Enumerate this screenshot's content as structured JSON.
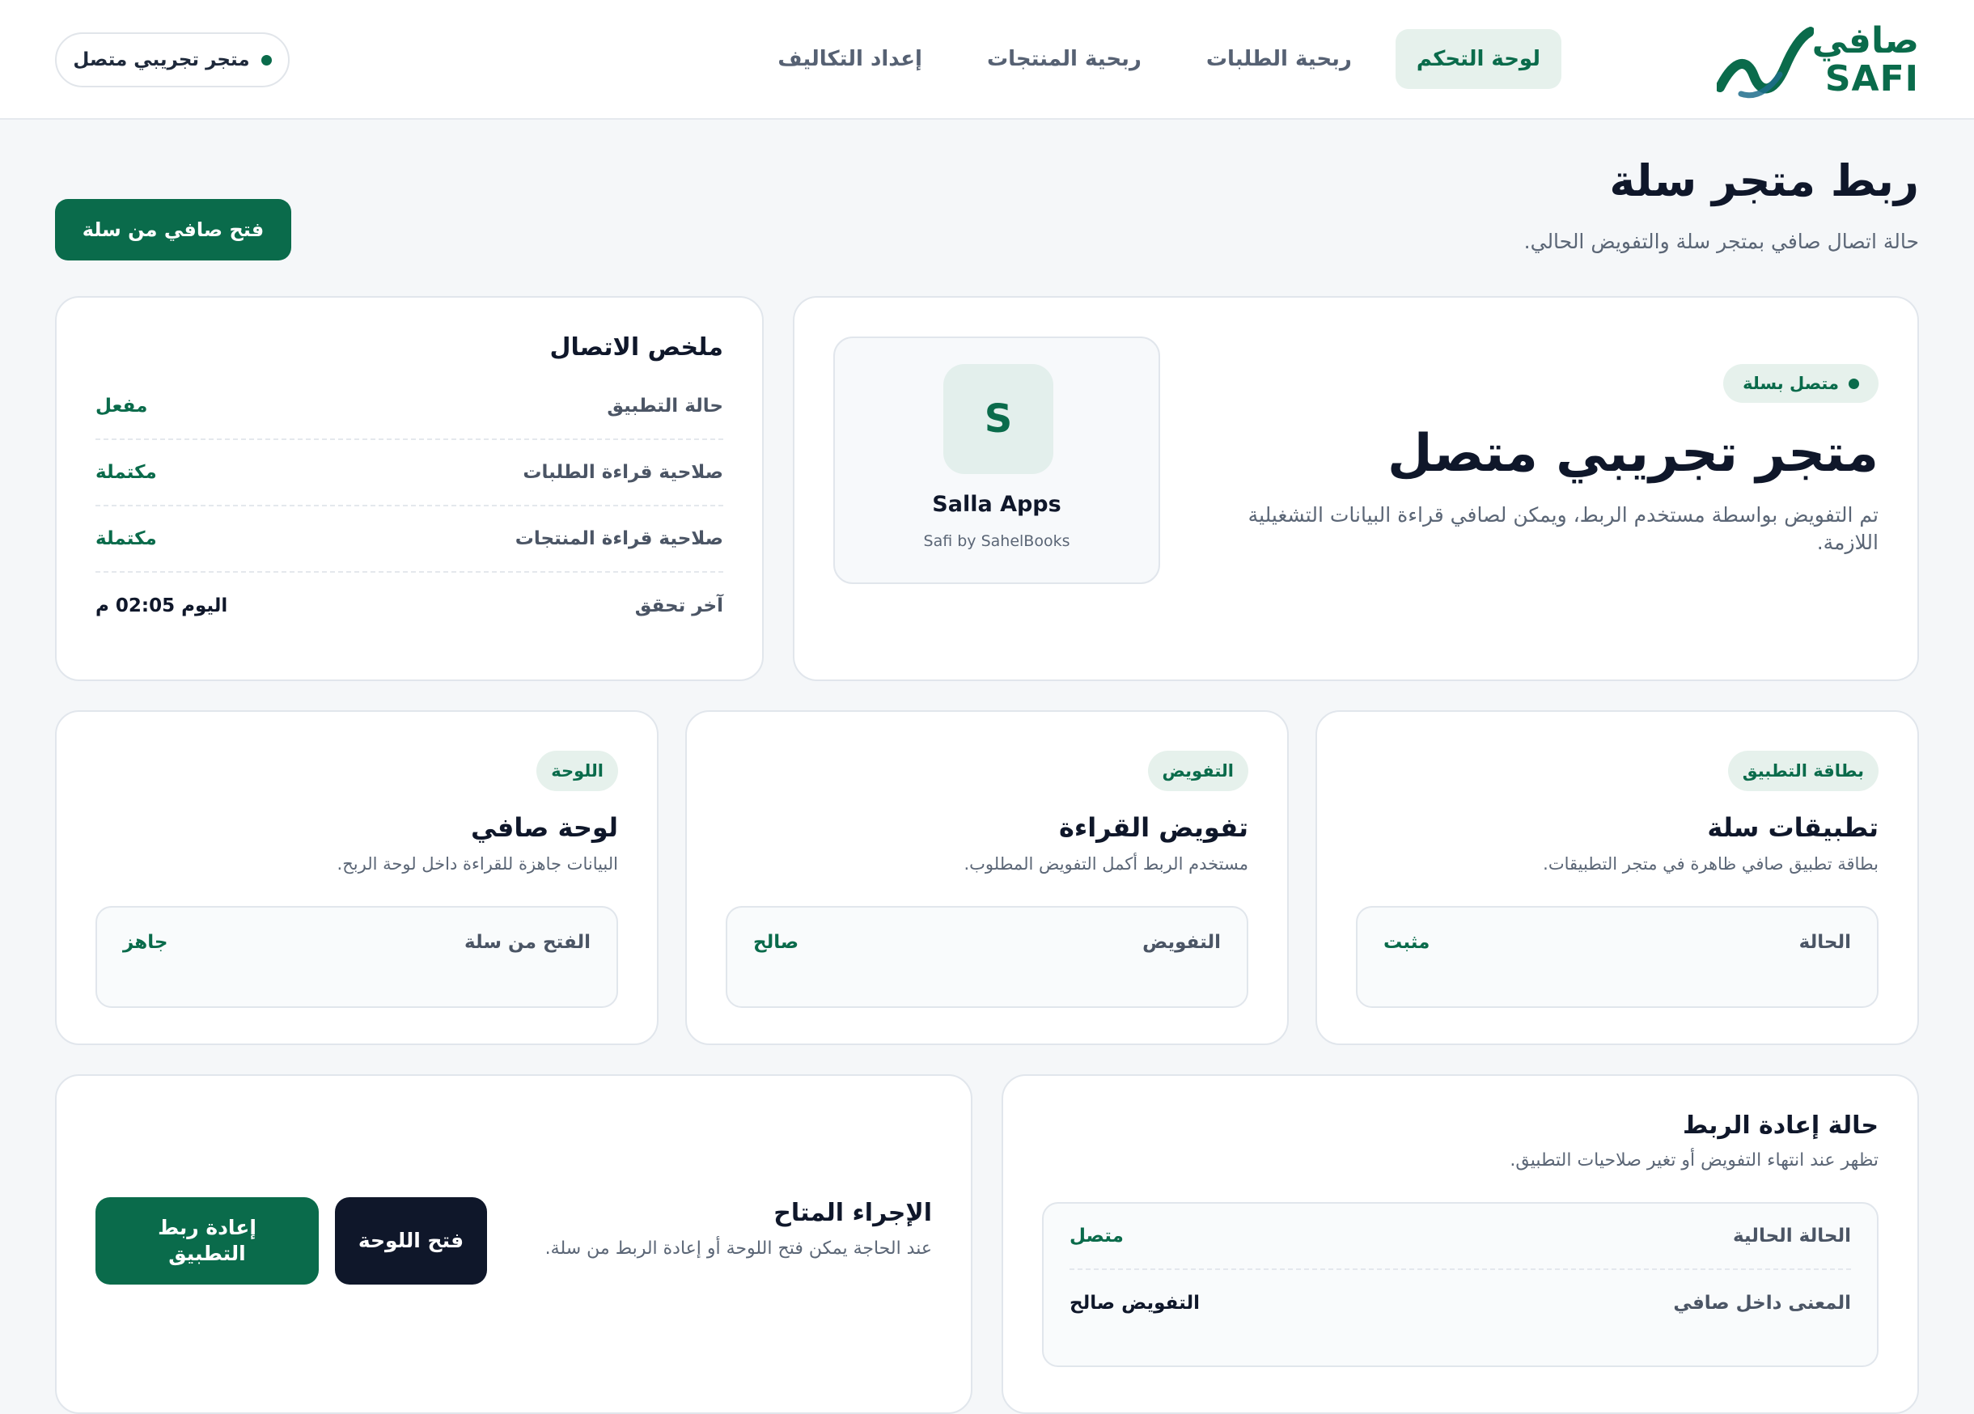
{
  "brand": {
    "name_ar": "صافي",
    "name_en": "SAFI",
    "color": "#0a6b4b",
    "logo_icon": "wave-logo-icon"
  },
  "nav": {
    "tabs": [
      {
        "label": "لوحة التحكم",
        "active": true
      },
      {
        "label": "ربحية الطلبات",
        "active": false
      },
      {
        "label": "ربحية المنتجات",
        "active": false
      },
      {
        "label": "إعداد التكاليف",
        "active": false
      }
    ],
    "store_status": "متجر تجريبي متصل"
  },
  "page": {
    "title": "ربط متجر سلة",
    "subtitle": "حالة اتصال صافي بمتجر سلة والتفويض الحالي.",
    "open_button": "فتح صافي من سلة"
  },
  "hero": {
    "status": "متصل بسلة",
    "store_name": "متجر تجريبي متصل",
    "description": "تم التفويض بواسطة مستخدم الربط، ويمكن لصافي قراءة البيانات التشغيلية اللازمة.",
    "app": {
      "avatar_letter": "S",
      "name": "Salla Apps",
      "subtitle": "Safi by SahelBooks"
    }
  },
  "summary": {
    "title": "ملخص الاتصال",
    "rows": [
      {
        "label": "حالة التطبيق",
        "value": "مفعل"
      },
      {
        "label": "صلاحية قراءة الطلبات",
        "value": "مكتملة"
      },
      {
        "label": "صلاحية قراءة المنتجات",
        "value": "مكتملة"
      },
      {
        "label": "آخر تحقق",
        "value": "اليوم 02:05 م"
      }
    ]
  },
  "cards": [
    {
      "badge": "بطاقة التطبيق",
      "title": "تطبيقات سلة",
      "description": "بطاقة تطبيق صافي ظاهرة في متجر التطبيقات.",
      "key": "الحالة",
      "value": "مثبت"
    },
    {
      "badge": "التفويض",
      "title": "تفويض القراءة",
      "description": "مستخدم الربط أكمل التفويض المطلوب.",
      "key": "التفويض",
      "value": "صالح"
    },
    {
      "badge": "اللوحة",
      "title": "لوحة صافي",
      "description": "البيانات جاهزة للقراءة داخل لوحة الربح.",
      "key": "الفتح من سلة",
      "value": "جاهز"
    }
  ],
  "reconnect": {
    "title": "حالة إعادة الربط",
    "description": "تظهر عند انتهاء التفويض أو تغير صلاحيات التطبيق.",
    "rows": [
      {
        "label": "الحالة الحالية",
        "value": "متصل"
      },
      {
        "label": "المعنى داخل صافي",
        "value": "التفويض صالح"
      }
    ]
  },
  "action": {
    "title": "الإجراء المتاح",
    "description": "عند الحاجة يمكن فتح اللوحة أو إعادة الربط من سلة.",
    "open_board": "فتح اللوحة",
    "reconnect_app": "إعادة ربط التطبيق"
  }
}
